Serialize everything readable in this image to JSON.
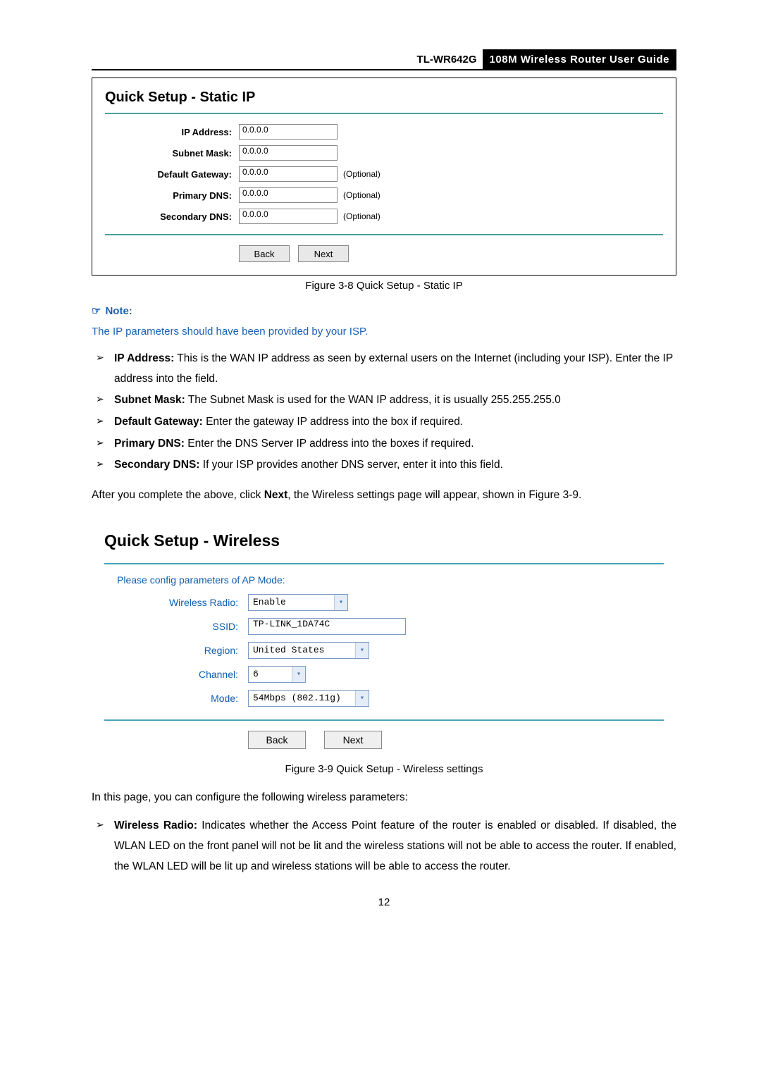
{
  "header": {
    "model": "TL-WR642G",
    "guide": "108M  Wireless  Router  User  Guide"
  },
  "figure1": {
    "title": "Quick Setup - Static IP",
    "fields": {
      "ip_address": {
        "label": "IP Address:",
        "value": "0.0.0.0"
      },
      "subnet_mask": {
        "label": "Subnet Mask:",
        "value": "0.0.0.0"
      },
      "default_gateway": {
        "label": "Default Gateway:",
        "value": "0.0.0.0",
        "optional": "(Optional)"
      },
      "primary_dns": {
        "label": "Primary DNS:",
        "value": "0.0.0.0",
        "optional": "(Optional)"
      },
      "secondary_dns": {
        "label": "Secondary DNS:",
        "value": "0.0.0.0",
        "optional": "(Optional)"
      }
    },
    "back": "Back",
    "next": "Next",
    "caption": "Figure 3-8    Quick Setup - Static IP"
  },
  "note": {
    "label": "Note:",
    "text": "The IP parameters should have been provided by your ISP."
  },
  "bullets1": [
    {
      "bold": "IP Address:",
      "text": " This is the WAN IP address as seen by external users on the Internet (including your ISP). Enter the IP address into the field."
    },
    {
      "bold": "Subnet Mask:",
      "text": " The Subnet Mask is used for the WAN IP address, it is usually 255.255.255.0"
    },
    {
      "bold": "Default Gateway:",
      "text": " Enter the gateway IP address into the box if required."
    },
    {
      "bold": "Primary DNS:",
      "text": " Enter the DNS Server IP address into the boxes if required."
    },
    {
      "bold": "Secondary DNS:",
      "text": " If your ISP provides another DNS server, enter it into this field."
    }
  ],
  "after_text": {
    "p1a": "After you complete the above, click ",
    "p1b": "Next",
    "p1c": ", the Wireless settings page will appear, shown in Figure 3-9."
  },
  "figure2": {
    "title": "Quick Setup - Wireless",
    "prompt": "Please config parameters of AP Mode:",
    "wireless_radio": {
      "label": "Wireless Radio:",
      "value": "Enable"
    },
    "ssid": {
      "label": "SSID:",
      "value": "TP-LINK_1DA74C"
    },
    "region": {
      "label": "Region:",
      "value": "United States"
    },
    "channel": {
      "label": "Channel:",
      "value": "6"
    },
    "mode": {
      "label": "Mode:",
      "value": "54Mbps (802.11g)"
    },
    "back": "Back",
    "next": "Next",
    "caption": "Figure 3-9    Quick Setup - Wireless settings"
  },
  "body2": "In this page, you can configure the following wireless parameters:",
  "bullets2": [
    {
      "bold": "Wireless Radio:",
      "text": " Indicates whether the Access Point feature of the router is enabled or disabled. If disabled, the WLAN LED on the front panel will not be lit and the wireless stations will not be able to access the router. If enabled, the WLAN LED will be lit up and wireless stations will be able to access the router."
    }
  ],
  "page_number": "12"
}
